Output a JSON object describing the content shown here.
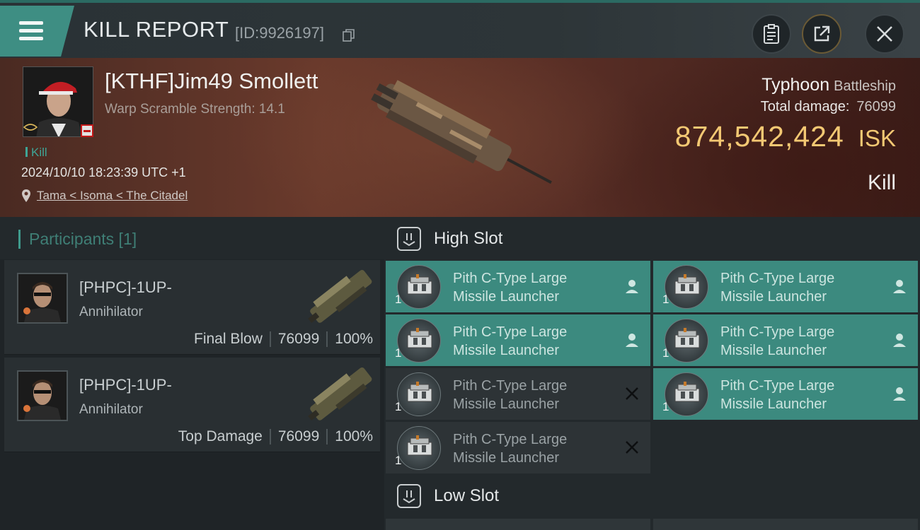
{
  "header": {
    "title": "KILL REPORT",
    "report_id": "[ID:9926197]",
    "icons": [
      "menu-icon",
      "copy-icon",
      "report-icon",
      "share-icon",
      "close-icon"
    ]
  },
  "victim": {
    "name": "[KTHF]Jim49 Smollett",
    "scramble": "Warp Scramble Strength: 14.1",
    "kill_label": "Kill",
    "datetime": "2024/10/10 18:23:39 UTC +1",
    "location": "Tama < Isoma < The Citadel",
    "ship_name": "Typhoon",
    "ship_class": "Battleship",
    "total_damage_label": "Total damage:",
    "total_damage": "76099",
    "isk_value": "874,542,424",
    "isk_unit": "ISK",
    "result": "Kill"
  },
  "participants": {
    "title": "Participants [1]",
    "items": [
      {
        "name": "[PHPC]-1UP-",
        "ship": "Annihilator",
        "role": "Final Blow",
        "damage": "76099",
        "percent": "100%"
      },
      {
        "name": "[PHPC]-1UP-",
        "ship": "Annihilator",
        "role": "Top Damage",
        "damage": "76099",
        "percent": "100%"
      }
    ]
  },
  "slots": {
    "high": {
      "title": "High Slot",
      "modules": [
        {
          "line1": "Pith C-Type Large",
          "line2": "Missile Launcher",
          "qty": "1",
          "state": "dropped"
        },
        {
          "line1": "Pith C-Type Large",
          "line2": "Missile Launcher",
          "qty": "1",
          "state": "dropped"
        },
        {
          "line1": "Pith C-Type Large",
          "line2": "Missile Launcher",
          "qty": "1",
          "state": "dropped"
        },
        {
          "line1": "Pith C-Type Large",
          "line2": "Missile Launcher",
          "qty": "1",
          "state": "dropped"
        },
        {
          "line1": "Pith C-Type Large",
          "line2": "Missile Launcher",
          "qty": "1",
          "state": "destroyed"
        },
        {
          "line1": "Pith C-Type Large",
          "line2": "Missile Launcher",
          "qty": "1",
          "state": "dropped"
        },
        {
          "line1": "Pith C-Type Large",
          "line2": "Missile Launcher",
          "qty": "1",
          "state": "destroyed"
        }
      ]
    },
    "low": {
      "title": "Low Slot"
    }
  },
  "colors": {
    "accent_teal": "#3c8a7f",
    "isk_gold": "#f3c873",
    "badge_red": "#c21818"
  }
}
